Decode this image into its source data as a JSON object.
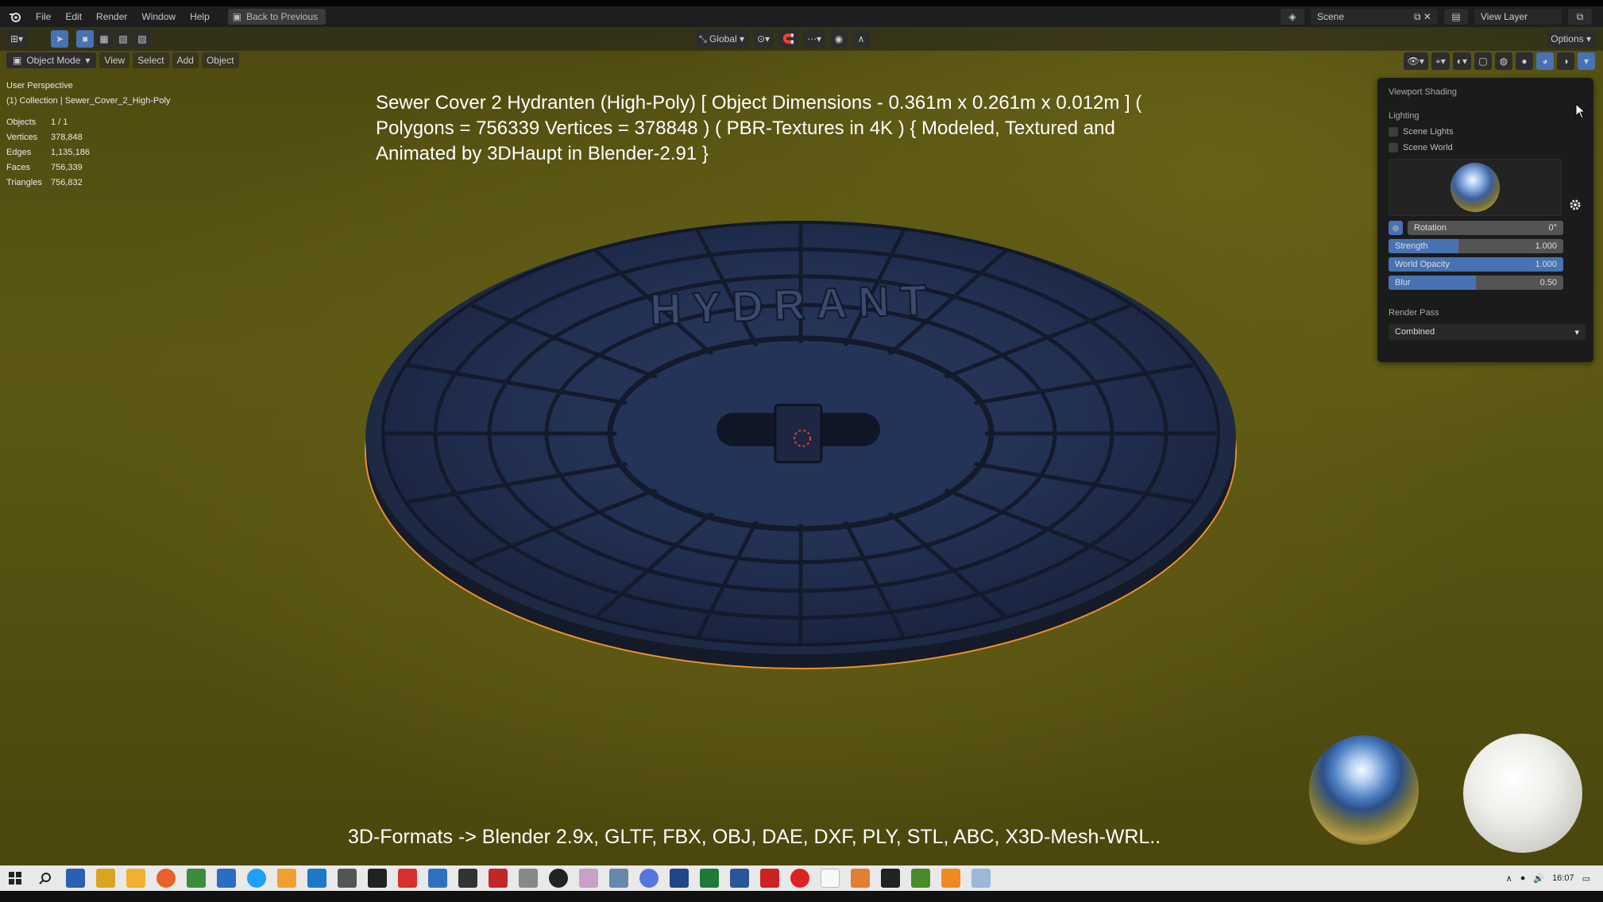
{
  "menubar": {
    "items": [
      "File",
      "Edit",
      "Render",
      "Window",
      "Help"
    ],
    "back_button": "Back to Previous",
    "scene_name": "Scene",
    "view_layer": "View Layer"
  },
  "header": {
    "orientation": "Global",
    "options_label": "Options"
  },
  "mode_row": {
    "mode": "Object Mode",
    "menus": [
      "View",
      "Select",
      "Add",
      "Object"
    ]
  },
  "stats": {
    "perspective": "User Perspective",
    "collection": "(1) Collection | Sewer_Cover_2_High-Poly",
    "rows": [
      {
        "k": "Objects",
        "v": "1 / 1"
      },
      {
        "k": "Vertices",
        "v": "378,848"
      },
      {
        "k": "Edges",
        "v": "1,135,186"
      },
      {
        "k": "Faces",
        "v": "756,339"
      },
      {
        "k": "Triangles",
        "v": "756,832"
      }
    ]
  },
  "overlay": {
    "description": "Sewer Cover 2 Hydranten (High-Poly) [ Object Dimensions -  0.361m x 0.261m x 0.012m ] ( Polygons = 756339 Vertices = 378848 ) ( PBR-Textures in 4K ) { Modeled, Textured and Animated by 3DHaupt in Blender-2.91 }",
    "formats": "3D-Formats -> Blender 2.9x, GLTF, FBX, OBJ, DAE, DXF, PLY, STL, ABC, X3D-Mesh-WRL..",
    "cover_text": "HYDRANT"
  },
  "shading_panel": {
    "title": "Viewport Shading",
    "lighting": "Lighting",
    "scene_lights": "Scene Lights",
    "scene_world": "Scene World",
    "rotation": {
      "label": "Rotation",
      "value": "0°"
    },
    "strength": {
      "label": "Strength",
      "value": "1.000",
      "fill": 0.4
    },
    "world_opacity": {
      "label": "World Opacity",
      "value": "1.000",
      "fill": 1.0
    },
    "blur": {
      "label": "Blur",
      "value": "0.50",
      "fill": 0.5
    },
    "render_pass_label": "Render Pass",
    "render_pass_value": "Combined"
  },
  "taskbar": {
    "time": "16:07"
  },
  "colors": {
    "accent": "#4772b3",
    "selection_outline": "#e8912d",
    "viewport_bg": "#5c5814"
  }
}
